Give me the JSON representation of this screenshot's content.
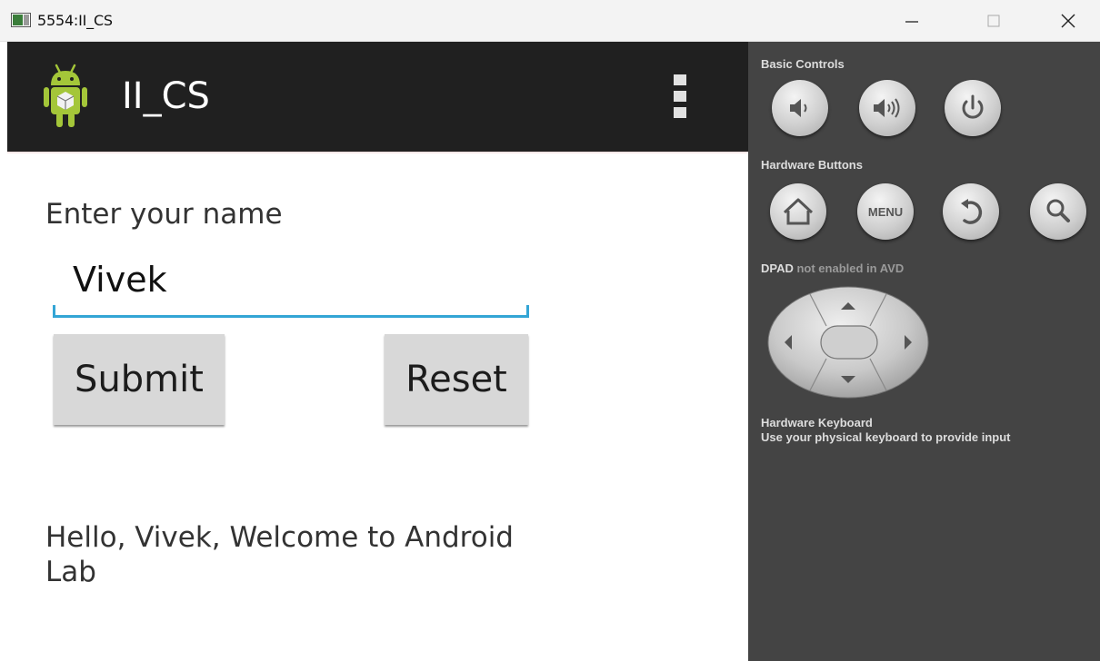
{
  "window": {
    "title": "5554:II_CS",
    "icons": [
      "app-window-icon",
      "minimize-icon",
      "maximize-icon",
      "close-icon"
    ]
  },
  "app": {
    "title": "II_CS",
    "icon": "android-robot-icon",
    "overflow_icon": "overflow-menu-icon"
  },
  "form": {
    "name_label": "Enter your name",
    "name_value": "Vivek",
    "submit_label": "Submit",
    "reset_label": "Reset",
    "message": "Hello, Vivek, Welcome to Android Lab"
  },
  "panel": {
    "basic_controls_label": "Basic Controls",
    "basic_buttons": [
      "volume-down-icon",
      "volume-up-icon",
      "power-icon"
    ],
    "hardware_buttons_label": "Hardware Buttons",
    "hardware_buttons": [
      "home-icon",
      "menu-button",
      "back-icon",
      "search-icon"
    ],
    "menu_label": "MENU",
    "dpad_label_strong": "DPAD",
    "dpad_label_rest": " not enabled in AVD",
    "keyboard_title": "Hardware Keyboard",
    "keyboard_desc": "Use your physical keyboard to provide input"
  },
  "colors": {
    "actionbar": "#202020",
    "panel": "#444444",
    "edit_underline": "#33a5d5",
    "button": "#d8d8d8"
  }
}
